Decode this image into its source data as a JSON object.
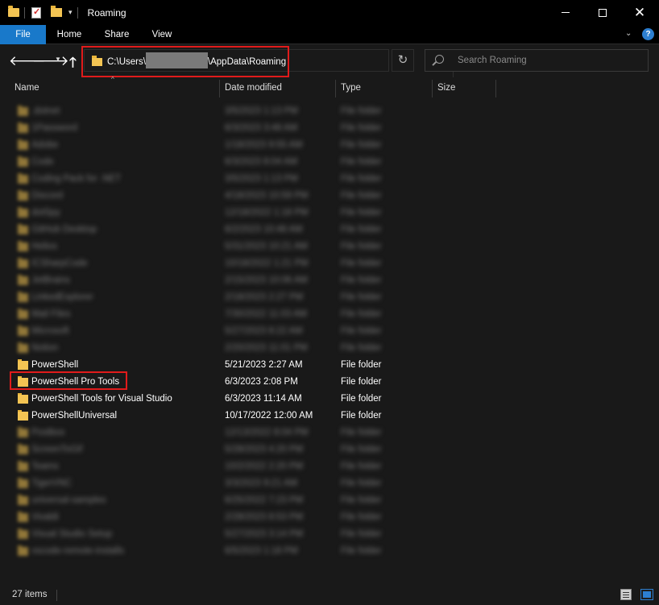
{
  "window": {
    "title": "Roaming"
  },
  "ribbon": {
    "tabs": [
      "File",
      "Home",
      "Share",
      "View"
    ]
  },
  "address": {
    "prefix": "C:\\Users\\",
    "suffix": "\\AppData\\Roaming"
  },
  "search": {
    "placeholder": "Search Roaming"
  },
  "columns": {
    "name": "Name",
    "date": "Date modified",
    "type": "Type",
    "size": "Size"
  },
  "files": [
    {
      "name": ".dotnet",
      "date": "3/5/2023 1:13 PM",
      "type": "File folder",
      "blurred": true
    },
    {
      "name": "1Password",
      "date": "6/3/2023 3:48 AM",
      "type": "File folder",
      "blurred": true
    },
    {
      "name": "Adobe",
      "date": "1/18/2023 9:55 AM",
      "type": "File folder",
      "blurred": true
    },
    {
      "name": "Code",
      "date": "6/3/2023 8:04 AM",
      "type": "File folder",
      "blurred": true
    },
    {
      "name": "Coding Pack for .NET",
      "date": "3/5/2023 1:13 PM",
      "type": "File folder",
      "blurred": true
    },
    {
      "name": "Discord",
      "date": "4/18/2023 10:59 PM",
      "type": "File folder",
      "blurred": true
    },
    {
      "name": "dotSpy",
      "date": "12/18/2022 1:18 PM",
      "type": "File folder",
      "blurred": true
    },
    {
      "name": "GitHub Desktop",
      "date": "6/2/2023 10:48 AM",
      "type": "File folder",
      "blurred": true
    },
    {
      "name": "Helios",
      "date": "5/31/2023 10:21 AM",
      "type": "File folder",
      "blurred": true
    },
    {
      "name": "ICSharpCode",
      "date": "10/18/2022 1:21 PM",
      "type": "File folder",
      "blurred": true
    },
    {
      "name": "JetBrains",
      "date": "2/15/2023 10:06 AM",
      "type": "File folder",
      "blurred": true
    },
    {
      "name": "LinkedExplorer",
      "date": "2/18/2023 2:27 PM",
      "type": "File folder",
      "blurred": true
    },
    {
      "name": "Mail Files",
      "date": "7/30/2022 11:03 AM",
      "type": "File folder",
      "blurred": true
    },
    {
      "name": "Microsoft",
      "date": "5/27/2023 8:22 AM",
      "type": "File folder",
      "blurred": true
    },
    {
      "name": "Notion",
      "date": "2/20/2023 11:01 PM",
      "type": "File folder",
      "blurred": true
    },
    {
      "name": "PowerShell",
      "date": "5/21/2023 2:27 AM",
      "type": "File folder",
      "blurred": false
    },
    {
      "name": "PowerShell Pro Tools",
      "date": "6/3/2023 2:08 PM",
      "type": "File folder",
      "blurred": false
    },
    {
      "name": "PowerShell Tools for Visual Studio",
      "date": "6/3/2023 11:14 AM",
      "type": "File folder",
      "blurred": false
    },
    {
      "name": "PowerShellUniversal",
      "date": "10/17/2022 12:00 AM",
      "type": "File folder",
      "blurred": false
    },
    {
      "name": "Postbox",
      "date": "12/13/2022 8:04 PM",
      "type": "File folder",
      "blurred": true
    },
    {
      "name": "ScreenToGif",
      "date": "5/28/2023 4:20 PM",
      "type": "File folder",
      "blurred": true
    },
    {
      "name": "Teams",
      "date": "10/2/2022 2:20 PM",
      "type": "File folder",
      "blurred": true
    },
    {
      "name": "TigerVNC",
      "date": "3/3/2023 9:21 AM",
      "type": "File folder",
      "blurred": true
    },
    {
      "name": "universal-samples",
      "date": "6/25/2022 7:23 PM",
      "type": "File folder",
      "blurred": true
    },
    {
      "name": "Vivaldi",
      "date": "2/28/2023 8:53 PM",
      "type": "File folder",
      "blurred": true
    },
    {
      "name": "Visual Studio Setup",
      "date": "5/27/2023 3:14 PM",
      "type": "File folder",
      "blurred": true
    },
    {
      "name": "vscode-remote-installs",
      "date": "6/5/2023 1:18 PM",
      "type": "File folder",
      "blurred": true
    }
  ],
  "status": {
    "item_count": "27 items"
  }
}
